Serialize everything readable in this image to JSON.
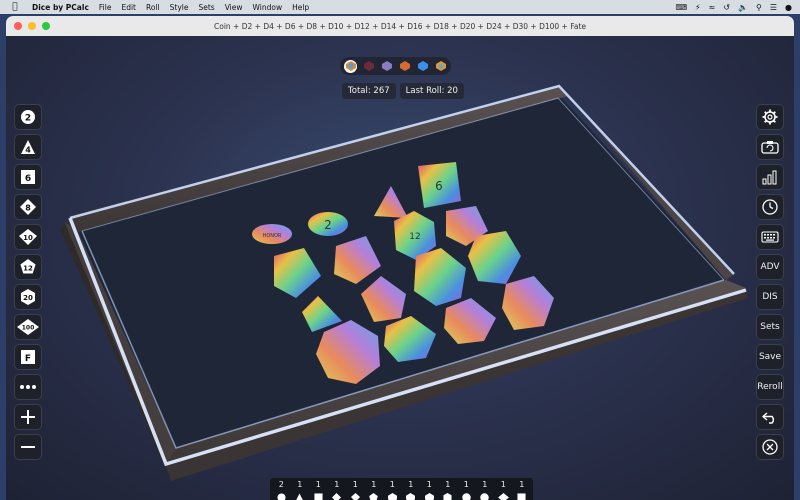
{
  "menubar": {
    "app_name": "Dice by PCalc",
    "items": [
      "File",
      "Edit",
      "Roll",
      "Style",
      "Sets",
      "View",
      "Window",
      "Help"
    ]
  },
  "window": {
    "title": "Coin + D2 + D4 + D6 + D8 + D10 + D12 + D14 + D16 + D18 + D20 + D24 + D30 + D100 + Fate"
  },
  "status": {
    "total": "Total: 267",
    "last_roll": "Last Roll: 20"
  },
  "dice_sets": [
    "rainbow-set",
    "dark-red-set",
    "purple-glass-set",
    "copper-set",
    "blue-crystal-set",
    "amber-set"
  ],
  "left_toolbar": {
    "d2": "2",
    "d4": "4",
    "d6": "6",
    "d8": "8",
    "d10": "10",
    "d12": "12",
    "d20": "20",
    "d100": "100",
    "fate": "F"
  },
  "right_toolbar": {
    "adv": "ADV",
    "dis": "DIS",
    "sets": "Sets",
    "save": "Save",
    "reroll": "Reroll"
  },
  "counters": [
    {
      "count": "2",
      "die": "coin"
    },
    {
      "count": "1",
      "die": "d4"
    },
    {
      "count": "1",
      "die": "d6"
    },
    {
      "count": "1",
      "die": "d8"
    },
    {
      "count": "1",
      "die": "d10"
    },
    {
      "count": "1",
      "die": "d12"
    },
    {
      "count": "1",
      "die": "d14"
    },
    {
      "count": "1",
      "die": "d16"
    },
    {
      "count": "1",
      "die": "d18"
    },
    {
      "count": "1",
      "die": "d20"
    },
    {
      "count": "1",
      "die": "d24"
    },
    {
      "count": "1",
      "die": "d30"
    },
    {
      "count": "1",
      "die": "d100"
    },
    {
      "count": "1",
      "die": "fate"
    }
  ],
  "dice_faces": {
    "coin_a": "HONOR",
    "coin_b": "2",
    "d6": "6",
    "d12": "12"
  },
  "colors": {
    "tray_glow": "#cfe0ff",
    "tray_wall": "#4b4545",
    "button_bg": "#1e2129"
  }
}
